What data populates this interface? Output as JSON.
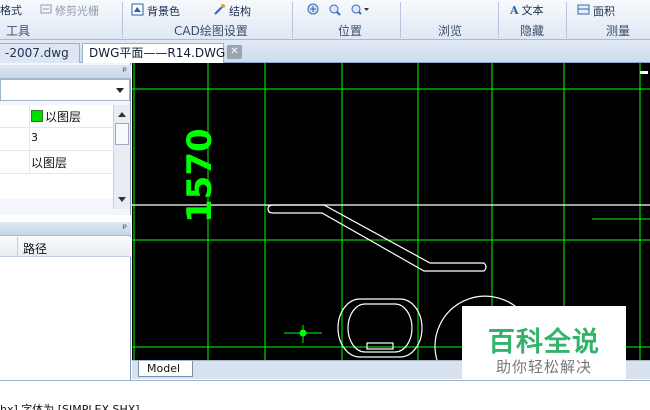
{
  "ribbon": {
    "items": [
      {
        "label": "格式",
        "icon": "format-icon"
      },
      {
        "label": "修剪光栅",
        "icon": "trim-raster-icon",
        "disabled": true
      },
      {
        "label": "背景色",
        "icon": "background-color-icon"
      },
      {
        "label": "结构",
        "icon": "structure-icon"
      },
      {
        "label": "文本",
        "icon": "text-icon"
      },
      {
        "label": "面积",
        "icon": "area-icon"
      }
    ],
    "view_buttons": [
      {
        "icon": "pan-icon"
      },
      {
        "icon": "zoom-icon"
      },
      {
        "icon": "zoom-dropdown-icon"
      }
    ],
    "groups": [
      "工具",
      "CAD绘图设置",
      "位置",
      "浏览",
      "隐藏",
      "测量"
    ]
  },
  "tabs": [
    {
      "label": "-2007.dwg"
    },
    {
      "label": "DWG平面——R14.DWG"
    }
  ],
  "properties_panel": {
    "pin": "ᵖ",
    "rows": [
      {
        "value": "以图层",
        "color": "#00e000"
      },
      {
        "value": "3"
      },
      {
        "value": "以图层"
      }
    ]
  },
  "files_panel": {
    "pin": "ᵖ",
    "column_header": "路径"
  },
  "drawing": {
    "dimension_text": "1570",
    "line_color": "#00ff00",
    "outline_color": "#ffffff",
    "background": "#000000"
  },
  "layout_tabs": [
    "Model"
  ],
  "command_line": {
    "text": "hx] 字体为 [SIMPLEX.SHX]"
  },
  "watermark": {
    "title": "百科全说",
    "subtitle": "助你轻松解决"
  }
}
